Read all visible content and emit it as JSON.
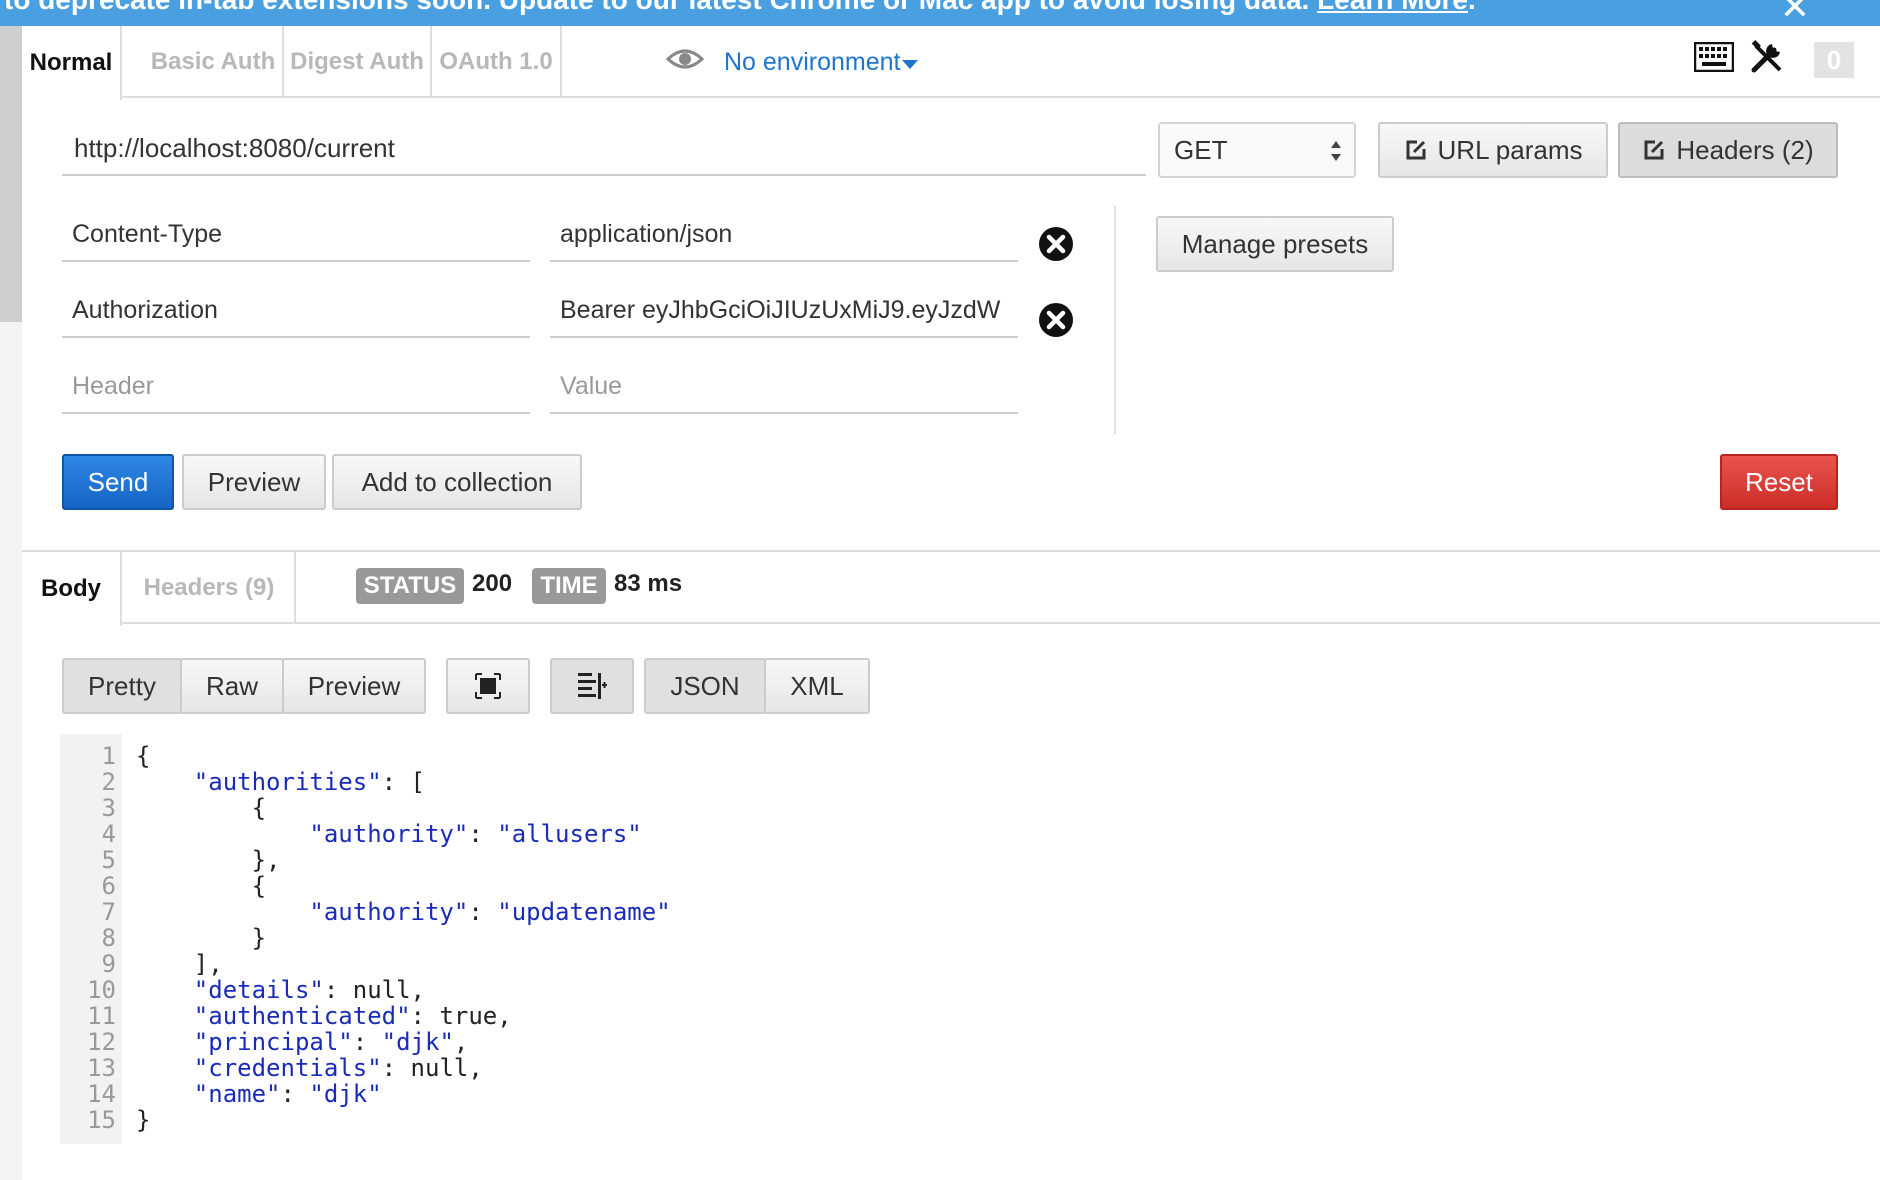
{
  "banner": {
    "text": "to deprecate in-tab extensions soon. Update to our latest Chrome or Mac app to avoid losing data.",
    "link": "Learn More",
    "close": "✕"
  },
  "auth_tabs": [
    "Normal",
    "Basic Auth",
    "Digest Auth",
    "OAuth 1.0"
  ],
  "environment": {
    "label": "No environment"
  },
  "toolbar": {
    "badge_count": "0",
    "keyboard_icon": "keyboard-icon",
    "tools_icon": "tools-icon"
  },
  "request": {
    "url": "http://localhost:8080/current",
    "method": "GET",
    "url_params_label": "URL params",
    "headers_label": "Headers (2)",
    "manage_presets_label": "Manage presets",
    "headers": [
      {
        "key": "Content-Type",
        "value": "application/json"
      },
      {
        "key": "Authorization",
        "value": "Bearer eyJhbGciOiJIUzUxMiJ9.eyJzdW"
      }
    ],
    "new_header_placeholder": "Header",
    "new_value_placeholder": "Value"
  },
  "actions": {
    "send": "Send",
    "preview": "Preview",
    "add_to_collection": "Add to collection",
    "reset": "Reset"
  },
  "response": {
    "tabs": [
      "Body",
      "Headers (9)"
    ],
    "status_label": "STATUS",
    "status_value": "200",
    "time_label": "TIME",
    "time_value": "83 ms",
    "view_modes": [
      "Pretty",
      "Raw",
      "Preview"
    ],
    "formats": [
      "JSON",
      "XML"
    ],
    "line_numbers": [
      "1",
      "2",
      "3",
      "4",
      "5",
      "6",
      "7",
      "8",
      "9",
      "10",
      "11",
      "12",
      "13",
      "14",
      "15"
    ]
  }
}
